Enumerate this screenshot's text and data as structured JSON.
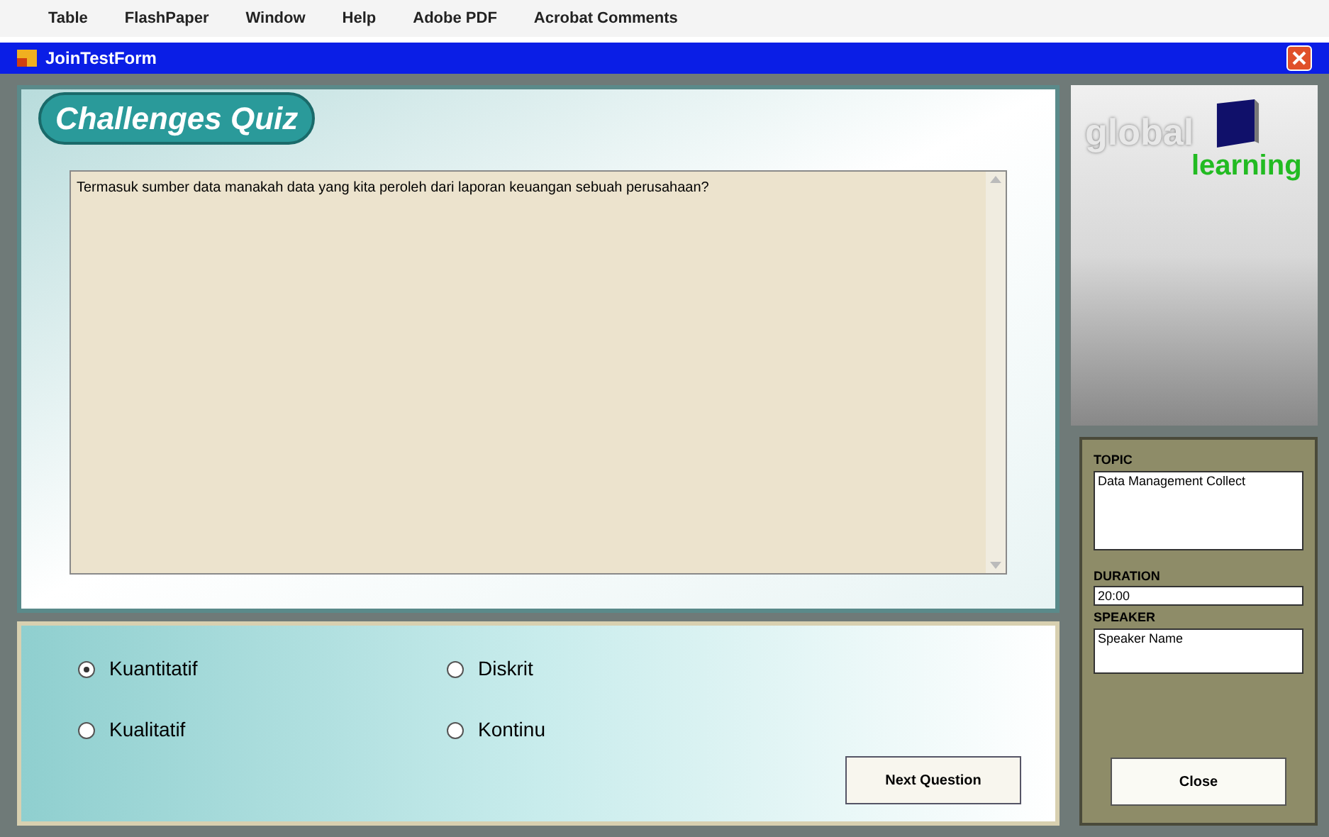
{
  "menu_bar": [
    "Table",
    "FlashPaper",
    "Window",
    "Help",
    "Adobe PDF",
    "Acrobat Comments"
  ],
  "window": {
    "title": "JoinTestForm"
  },
  "quiz": {
    "title": "Challenges Quiz",
    "question": "Termasuk sumber data manakah data yang kita peroleh dari laporan keuangan sebuah perusahaan?"
  },
  "logo": {
    "word_1": "global",
    "word_2": "learning"
  },
  "answers": [
    {
      "label": "Kuantitatif",
      "selected": true
    },
    {
      "label": "Diskrit",
      "selected": false
    },
    {
      "label": "Kualitatif",
      "selected": false
    },
    {
      "label": "Kontinu",
      "selected": false
    }
  ],
  "next_button": "Next Question",
  "info": {
    "topic_label": "TOPIC",
    "topic": "Data Management  Collect",
    "duration_label": "DURATION",
    "duration": "20:00",
    "speaker_label": "SPEAKER",
    "speaker": "Speaker Name"
  },
  "close_button": "Close"
}
